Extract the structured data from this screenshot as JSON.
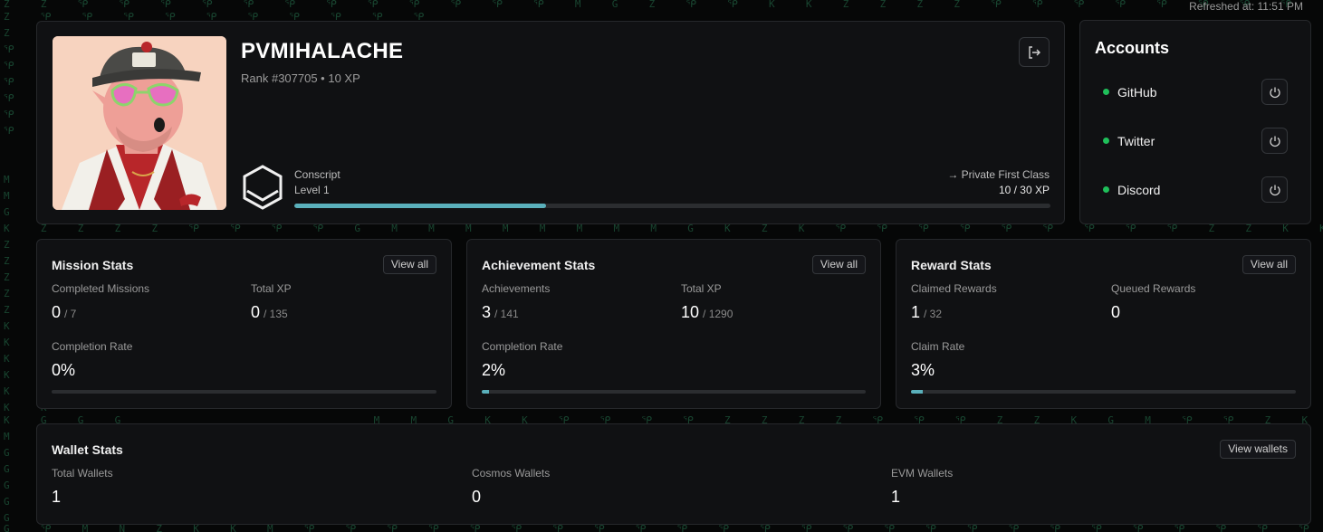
{
  "header": {
    "refreshed": "Refreshed at: 11:51 PM"
  },
  "profile": {
    "username": "PVMIHALACHE",
    "rank_line": "Rank #307705 • 10 XP",
    "current_rank": "Conscript",
    "level": "Level 1",
    "next_rank": "→ Private First Class",
    "xp_progress": "10 / 30 XP",
    "xp_fraction": 0.333
  },
  "accounts": {
    "title": "Accounts",
    "items": [
      {
        "label": "GitHub",
        "status_color": "#1fbf5a"
      },
      {
        "label": "Twitter",
        "status_color": "#1fbf5a"
      },
      {
        "label": "Discord",
        "status_color": "#1fbf5a"
      }
    ]
  },
  "mission_stats": {
    "title": "Mission Stats",
    "view_label": "View all",
    "completed_label": "Completed Missions",
    "completed_value": "0",
    "completed_total": "/ 7",
    "xp_label": "Total XP",
    "xp_value": "0",
    "xp_total": "/ 135",
    "rate_label": "Completion Rate",
    "rate_value": "0%",
    "rate_fraction": 0
  },
  "achievement_stats": {
    "title": "Achievement Stats",
    "view_label": "View all",
    "achievements_label": "Achievements",
    "achievements_value": "3",
    "achievements_total": "/ 141",
    "xp_label": "Total XP",
    "xp_value": "10",
    "xp_total": "/ 1290",
    "rate_label": "Completion Rate",
    "rate_value": "2%",
    "rate_fraction": 0.02
  },
  "reward_stats": {
    "title": "Reward Stats",
    "view_label": "View all",
    "claimed_label": "Claimed Rewards",
    "claimed_value": "1",
    "claimed_total": "/ 32",
    "queued_label": "Queued Rewards",
    "queued_value": "0",
    "rate_label": "Claim Rate",
    "rate_value": "3%",
    "rate_fraction": 0.03
  },
  "wallet_stats": {
    "title": "Wallet Stats",
    "view_label": "View wallets",
    "total_label": "Total Wallets",
    "total_value": "1",
    "cosmos_label": "Cosmos Wallets",
    "cosmos_value": "0",
    "evm_label": "EVM Wallets",
    "evm_value": "1"
  },
  "icons": {
    "logout": "logout-icon",
    "power": "power-icon",
    "rank_emblem": "hexagon-rank-icon"
  },
  "colors": {
    "accent": "#5ab0bb",
    "status_online": "#1fbf5a",
    "card_bg": "#101113"
  }
}
